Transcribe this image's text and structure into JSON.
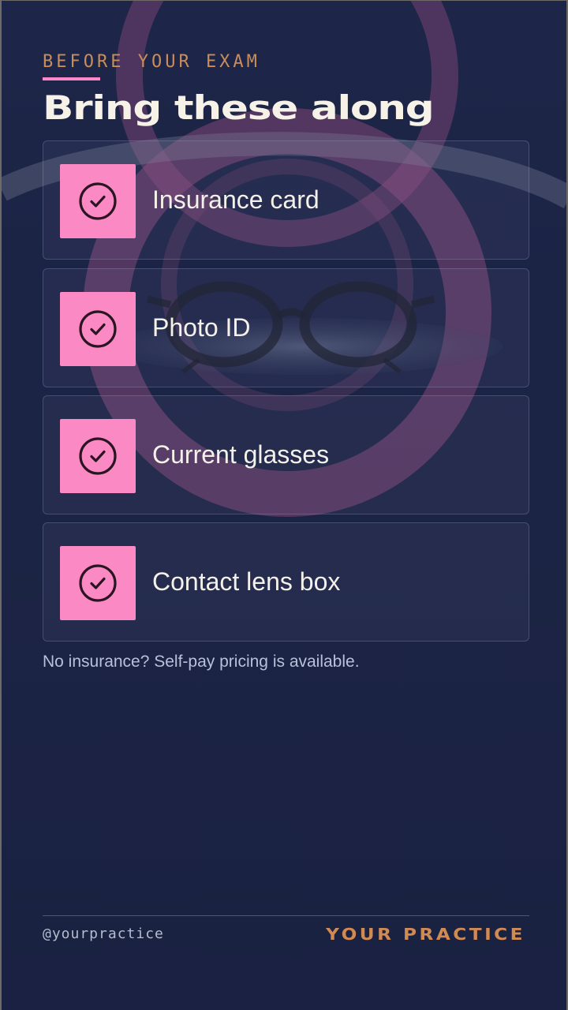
{
  "header": {
    "eyebrow": "BEFORE YOUR EXAM",
    "title": "Bring these along"
  },
  "checklist": [
    {
      "label": "Insurance card",
      "icon": "check-circle-icon",
      "checked": true
    },
    {
      "label": "Photo ID",
      "icon": "check-circle-icon",
      "checked": true
    },
    {
      "label": "Current glasses",
      "icon": "check-circle-icon",
      "checked": true
    },
    {
      "label": "Contact lens box",
      "icon": "check-circle-icon",
      "checked": true
    }
  ],
  "note": "No insurance? Self-pay pricing is available.",
  "footer": {
    "handle": "@yourpractice",
    "brand": "YOUR PRACTICE"
  },
  "colors": {
    "background": "#1c2445",
    "accent_pink": "#fb89c3",
    "accent_orange": "#c98d5b",
    "title_text": "#f7f2e8"
  }
}
